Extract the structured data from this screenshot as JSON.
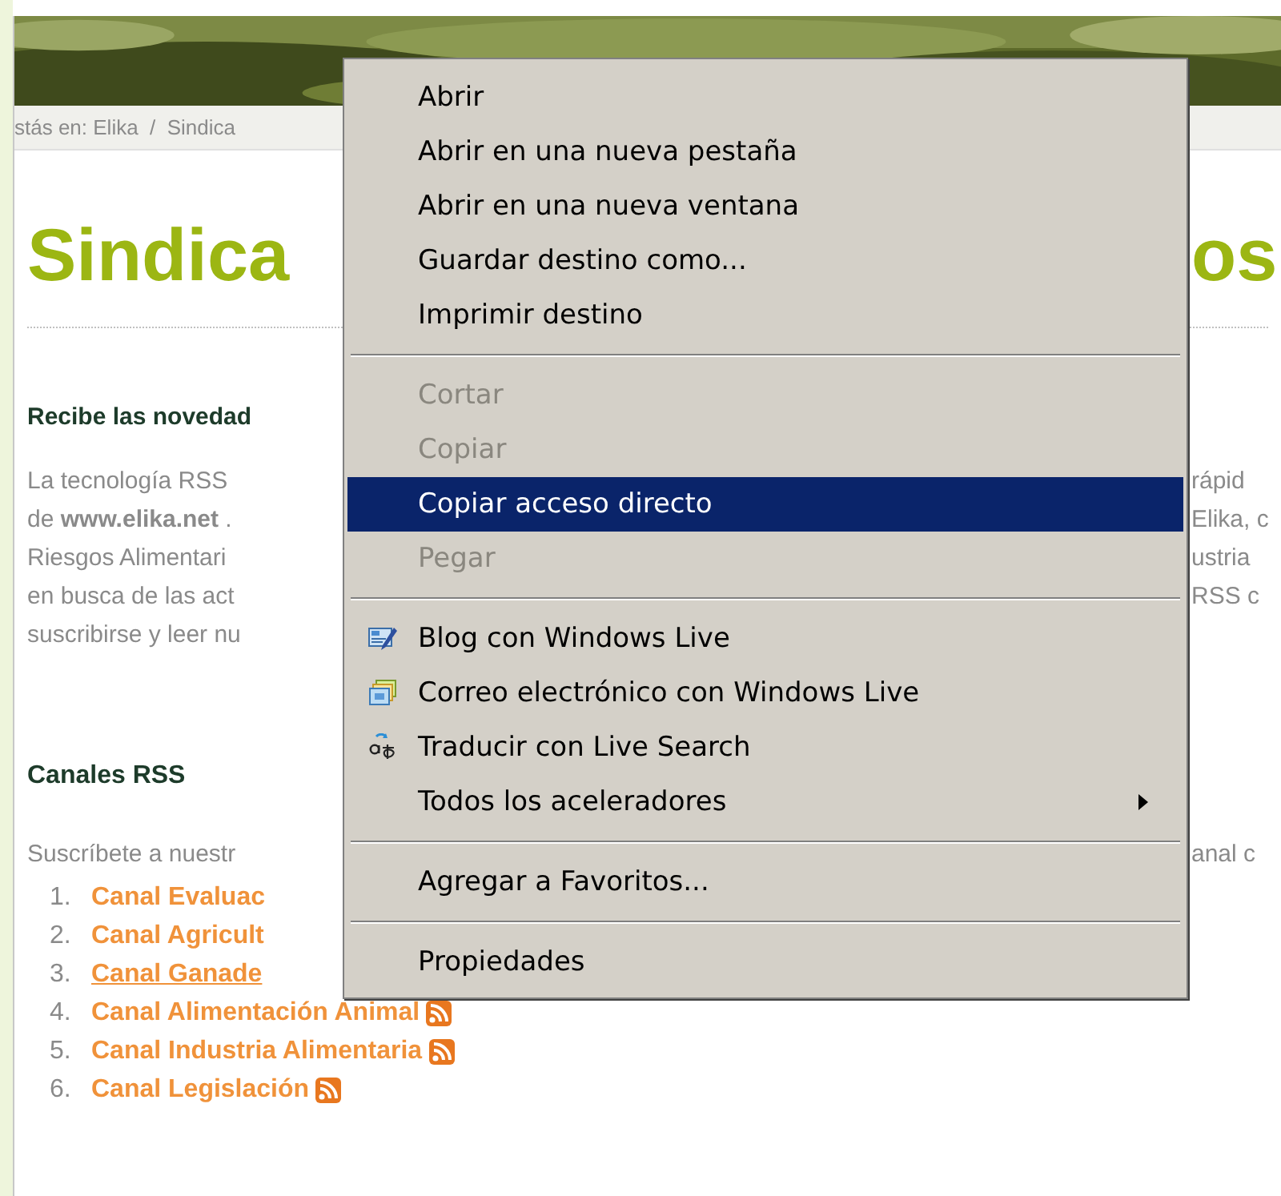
{
  "breadcrumb": "stás en: Elika  /  Sindica",
  "title": {
    "left": "Sindica",
    "right": "os"
  },
  "intro_heading": "Recibe las novedad",
  "paragraph_lines": [
    {
      "left": "La tecnología RSS",
      "right": "rápid"
    },
    {
      "left": "de **www.elika.net** .",
      "right": "Elika, c"
    },
    {
      "left": "Riesgos Alimentari",
      "right": "ustria"
    },
    {
      "left": "en busca de las act",
      "right": "RSS c"
    },
    {
      "left": "suscribirse y leer nu"
    }
  ],
  "channels_heading": "Canales RSS",
  "channels_intro": {
    "left": "Suscríbete a nuestr",
    "right": "anal c"
  },
  "channels": [
    {
      "number": "1.",
      "label": "Canal Evaluac",
      "hovered": false,
      "rss_icon": false
    },
    {
      "number": "2.",
      "label": "Canal Agricult",
      "hovered": false,
      "rss_icon": false
    },
    {
      "number": "3.",
      "label": "Canal Ganade",
      "hovered": true,
      "rss_icon": false
    },
    {
      "number": "4.",
      "label": "Canal Alimentación Animal",
      "hovered": false,
      "rss_icon": true
    },
    {
      "number": "5.",
      "label": "Canal Industria Alimentaria",
      "hovered": false,
      "rss_icon": true
    },
    {
      "number": "6.",
      "label": "Canal Legislación",
      "hovered": false,
      "rss_icon": true
    }
  ],
  "context_menu": [
    {
      "kind": "item",
      "label": "Abrir",
      "disabled": false,
      "selected": false
    },
    {
      "kind": "item",
      "label": "Abrir en una nueva pestaña",
      "disabled": false,
      "selected": false
    },
    {
      "kind": "item",
      "label": "Abrir en una nueva ventana",
      "disabled": false,
      "selected": false
    },
    {
      "kind": "item",
      "label": "Guardar destino como...",
      "disabled": false,
      "selected": false
    },
    {
      "kind": "item",
      "label": "Imprimir destino",
      "disabled": false,
      "selected": false
    },
    {
      "kind": "separator"
    },
    {
      "kind": "item",
      "label": "Cortar",
      "disabled": true,
      "selected": false
    },
    {
      "kind": "item",
      "label": "Copiar",
      "disabled": true,
      "selected": false
    },
    {
      "kind": "item",
      "label": "Copiar acceso directo",
      "disabled": false,
      "selected": true
    },
    {
      "kind": "item",
      "label": "Pegar",
      "disabled": true,
      "selected": false
    },
    {
      "kind": "separator"
    },
    {
      "kind": "blog",
      "label": "Blog con Windows Live",
      "disabled": false,
      "selected": false
    },
    {
      "kind": "email",
      "label": "Correo electrónico con Windows Live",
      "disabled": false,
      "selected": false
    },
    {
      "kind": "translate",
      "label": "Traducir con Live Search",
      "disabled": false,
      "selected": false
    },
    {
      "kind": "submenu",
      "label": "Todos los aceleradores",
      "disabled": false,
      "selected": false
    },
    {
      "kind": "separator"
    },
    {
      "kind": "item",
      "label": "Agregar a Favoritos...",
      "disabled": false,
      "selected": false
    },
    {
      "kind": "separator"
    },
    {
      "kind": "item",
      "label": "Propiedades",
      "disabled": false,
      "selected": false
    }
  ]
}
